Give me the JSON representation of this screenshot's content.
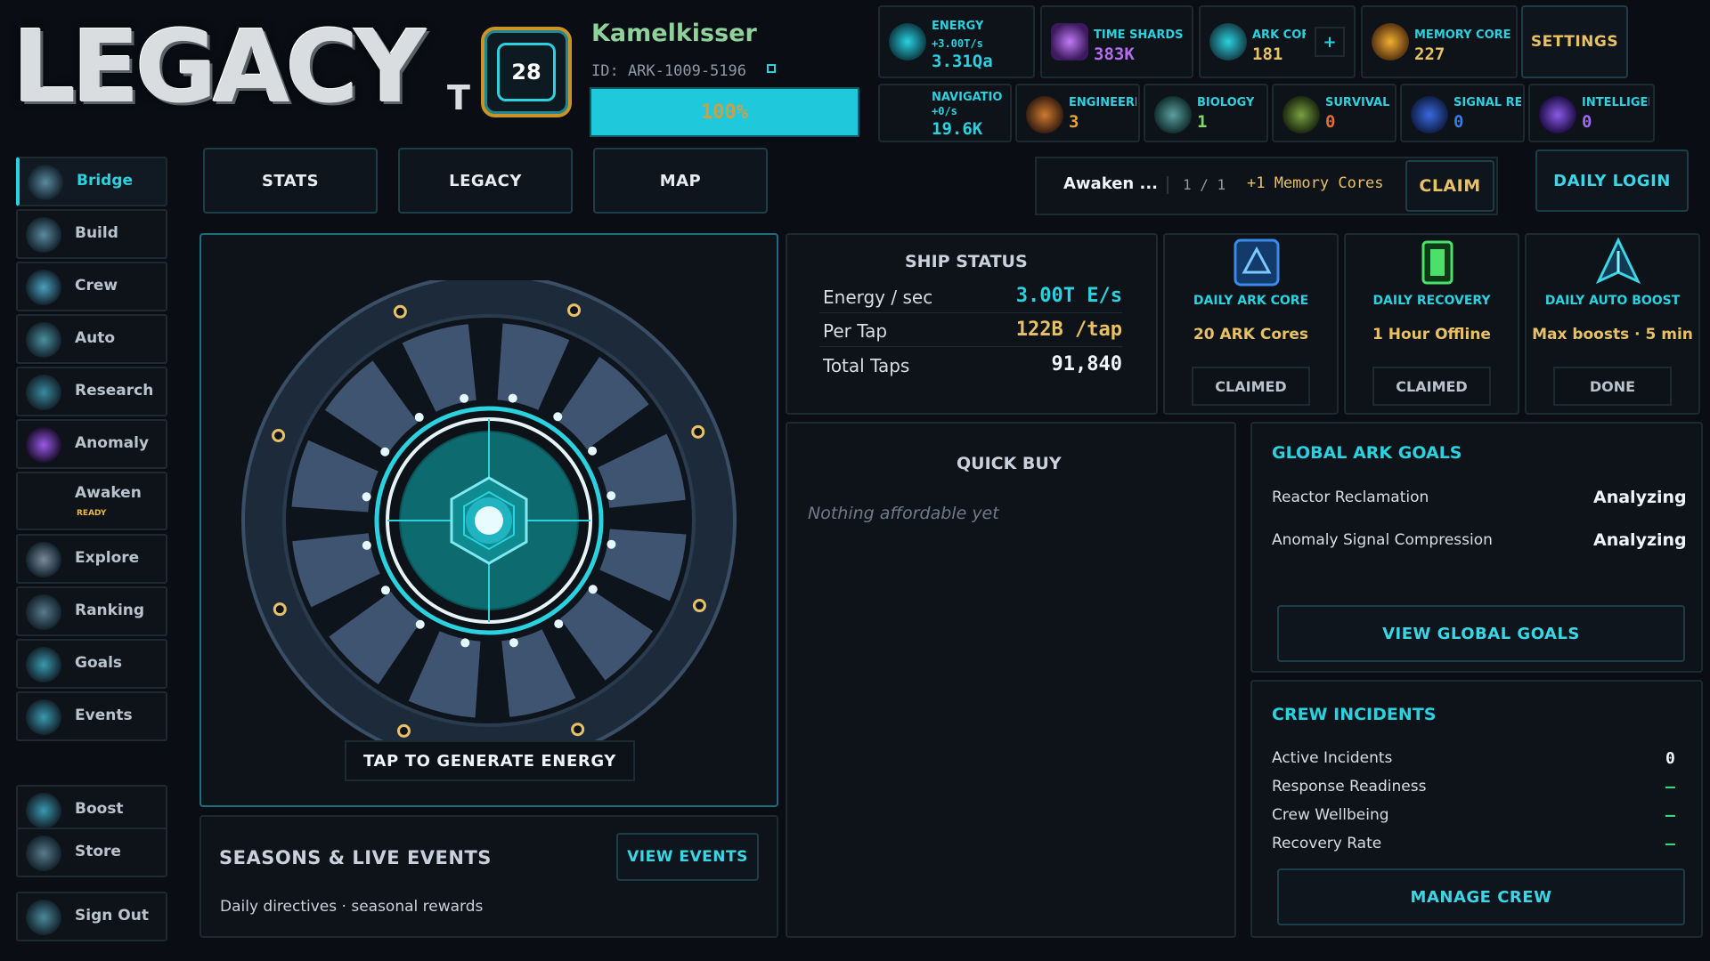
{
  "header": {
    "logo": "LEGACY",
    "logo_suffix": "T",
    "level": "28",
    "player_name": "Kamelkisser",
    "player_id": "ID: ARK-1009-5196",
    "xp_progress": "100%",
    "xp_fraction": 1.0
  },
  "resources_top": [
    {
      "label": "ENERGY",
      "sub": "+3.00T/s",
      "value": "3.31Qa",
      "icon": "lightning-icon",
      "color": "#2ad1df"
    },
    {
      "label": "TIME SHARDS",
      "value": "383K",
      "icon": "crystal-icon",
      "color": "#b66cf0"
    },
    {
      "label": "ARK COF",
      "value": "181",
      "icon": "ark-core-icon",
      "color": "#e8c066"
    },
    {
      "label": "MEMORY CORE",
      "value": "227",
      "icon": "memory-core-icon",
      "color": "#e8c066"
    }
  ],
  "add_button": "+",
  "settings_label": "SETTINGS",
  "resources_bottom": [
    {
      "label": "NAVIGATIO",
      "sub": "+0/s",
      "value": "19.6K",
      "icon": "compass-icon",
      "color": "#2ad1df"
    },
    {
      "label": "ENGINEERII",
      "value": "3",
      "icon": "engineering-icon",
      "color": "#e8a23a"
    },
    {
      "label": "BIOLOGY",
      "value": "1",
      "icon": "biology-icon",
      "color": "#7ed86a"
    },
    {
      "label": "SURVIVAL",
      "value": "0",
      "icon": "survival-icon",
      "color": "#e8683a"
    },
    {
      "label": "SIGNAL REI",
      "value": "0",
      "icon": "signal-icon",
      "color": "#3a7ae8"
    },
    {
      "label": "INTELLIGEN",
      "value": "0",
      "icon": "intelligence-icon",
      "color": "#9a6af0"
    }
  ],
  "tabs": [
    "STATS",
    "LEGACY",
    "MAP"
  ],
  "awaken": {
    "name": "Awaken ...",
    "count": "1 / 1",
    "reward": "+1 Memory Cores",
    "claim": "CLAIM"
  },
  "daily_login": "DAILY LOGIN",
  "sidebar": [
    {
      "label": "Bridge",
      "icon": "bridge-icon",
      "active": true
    },
    {
      "label": "Build",
      "icon": "build-icon"
    },
    {
      "label": "Crew",
      "icon": "crew-icon"
    },
    {
      "label": "Auto",
      "icon": "auto-icon"
    },
    {
      "label": "Research",
      "icon": "research-icon"
    },
    {
      "label": "Anomaly",
      "icon": "anomaly-icon"
    },
    {
      "label": "Awaken",
      "icon": "awaken-icon",
      "badge": "READY"
    },
    {
      "label": "Explore",
      "icon": "explore-icon"
    },
    {
      "label": "Ranking",
      "icon": "ranking-icon"
    },
    {
      "label": "Goals",
      "icon": "goals-icon"
    },
    {
      "label": "Events",
      "icon": "events-icon"
    },
    {
      "label": "Boost",
      "icon": "boost-icon"
    },
    {
      "label": "Store",
      "icon": "store-icon"
    },
    {
      "label": "Sign Out",
      "icon": "sign-out-icon"
    }
  ],
  "reactor": {
    "tap_label": "TAP TO GENERATE ENERGY"
  },
  "ship_status": {
    "title": "SHIP STATUS",
    "rows": [
      {
        "key": "Energy / sec",
        "value": "3.00T E/s",
        "color": "#2ad1df"
      },
      {
        "key": "Per Tap",
        "value": "122B /tap",
        "color": "#e8c066"
      },
      {
        "key": "Total Taps",
        "value": "91,840",
        "color": "#f0f4f8"
      }
    ]
  },
  "daily_cards": [
    {
      "title": "DAILY ARK CORE",
      "desc": "20 ARK Cores",
      "button": "CLAIMED",
      "icon": "ark-core-daily-icon"
    },
    {
      "title": "DAILY RECOVERY",
      "desc": "1 Hour Offline",
      "button": "CLAIMED",
      "icon": "recovery-daily-icon"
    },
    {
      "title": "DAILY AUTO BOOST",
      "desc": "Max boosts · 5 min",
      "button": "DONE",
      "icon": "auto-boost-daily-icon"
    }
  ],
  "quick_buy": {
    "title": "QUICK BUY",
    "empty": "Nothing affordable yet"
  },
  "global_goals": {
    "title": "GLOBAL ARK GOALS",
    "rows": [
      {
        "key": "Reactor Reclamation",
        "value": "Analyzing"
      },
      {
        "key": "Anomaly Signal Compression",
        "value": "Analyzing"
      }
    ],
    "button": "VIEW GLOBAL GOALS"
  },
  "crew_incidents": {
    "title": "CREW INCIDENTS",
    "rows": [
      {
        "key": "Active Incidents",
        "value": "0",
        "color": "#f0f4f8"
      },
      {
        "key": "Response Readiness",
        "value": "–",
        "color": "#3ad67a"
      },
      {
        "key": "Crew Wellbeing",
        "value": "–",
        "color": "#3ad67a"
      },
      {
        "key": "Recovery Rate",
        "value": "–",
        "color": "#3ad67a"
      }
    ],
    "button": "MANAGE CREW"
  },
  "seasons": {
    "title": "SEASONS & LIVE EVENTS",
    "subtitle": "Daily directives · seasonal rewards",
    "button": "VIEW EVENTS"
  }
}
